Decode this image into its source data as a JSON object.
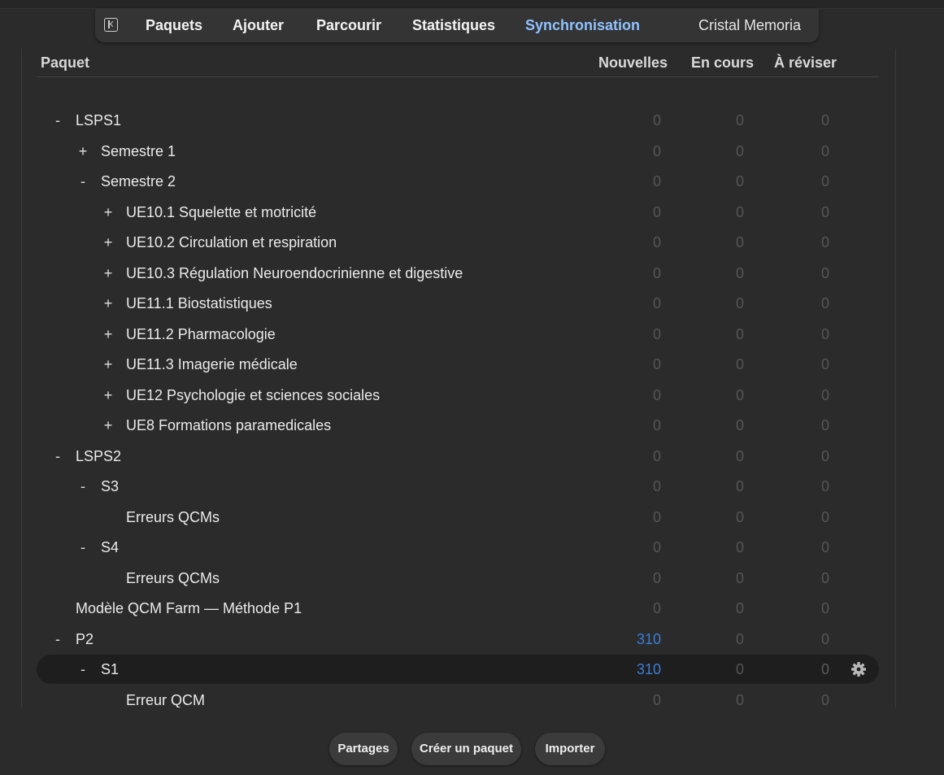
{
  "toolbar": {
    "items": [
      "Paquets",
      "Ajouter",
      "Parcourir",
      "Statistiques",
      "Synchronisation"
    ],
    "active": "Synchronisation",
    "profile": "Cristal Memoria",
    "accent_color": "#8fc2ff"
  },
  "table": {
    "headers": {
      "deck": "Paquet",
      "new": "Nouvelles",
      "learn": "En cours",
      "due": "À réviser"
    },
    "rows": [
      {
        "toggle": "-",
        "name": "LSPS1",
        "new": "0",
        "learn": "0",
        "due": "0"
      },
      {
        "toggle": "+",
        "name": "Semestre 1",
        "new": "0",
        "learn": "0",
        "due": "0"
      },
      {
        "toggle": "-",
        "name": "Semestre 2",
        "new": "0",
        "learn": "0",
        "due": "0"
      },
      {
        "toggle": "+",
        "name": "UE10.1 Squelette et motricité",
        "new": "0",
        "learn": "0",
        "due": "0"
      },
      {
        "toggle": "+",
        "name": "UE10.2 Circulation et respiration",
        "new": "0",
        "learn": "0",
        "due": "0"
      },
      {
        "toggle": "+",
        "name": "UE10.3 Régulation Neuroendocrinienne et digestive",
        "new": "0",
        "learn": "0",
        "due": "0"
      },
      {
        "toggle": "+",
        "name": "UE11.1 Biostatistiques",
        "new": "0",
        "learn": "0",
        "due": "0"
      },
      {
        "toggle": "+",
        "name": "UE11.2 Pharmacologie",
        "new": "0",
        "learn": "0",
        "due": "0"
      },
      {
        "toggle": "+",
        "name": "UE11.3 Imagerie médicale",
        "new": "0",
        "learn": "0",
        "due": "0"
      },
      {
        "toggle": "+",
        "name": "UE12 Psychologie et sciences sociales",
        "new": "0",
        "learn": "0",
        "due": "0"
      },
      {
        "toggle": "+",
        "name": "UE8 Formations paramedicales",
        "new": "0",
        "learn": "0",
        "due": "0"
      },
      {
        "toggle": "-",
        "name": "LSPS2",
        "new": "0",
        "learn": "0",
        "due": "0"
      },
      {
        "toggle": "-",
        "name": "S3",
        "new": "0",
        "learn": "0",
        "due": "0"
      },
      {
        "toggle": "",
        "name": "Erreurs QCMs",
        "new": "0",
        "learn": "0",
        "due": "0"
      },
      {
        "toggle": "-",
        "name": "S4",
        "new": "0",
        "learn": "0",
        "due": "0"
      },
      {
        "toggle": "",
        "name": "Erreurs QCMs",
        "new": "0",
        "learn": "0",
        "due": "0"
      },
      {
        "toggle": "",
        "name": "Modèle QCM Farm — Méthode P1",
        "new": "0",
        "learn": "0",
        "due": "0"
      },
      {
        "toggle": "-",
        "name": "P2",
        "new": "310",
        "learn": "0",
        "due": "0"
      },
      {
        "toggle": "-",
        "name": "S1",
        "new": "310",
        "learn": "0",
        "due": "0"
      },
      {
        "toggle": "",
        "name": "Erreur QCM",
        "new": "0",
        "learn": "0",
        "due": "0"
      }
    ],
    "new_color": "#3b7dd8",
    "zero_color": "#555555"
  },
  "bottom": {
    "shared_label": "Partages",
    "create_label": "Créer un paquet",
    "import_label": "Importer"
  }
}
